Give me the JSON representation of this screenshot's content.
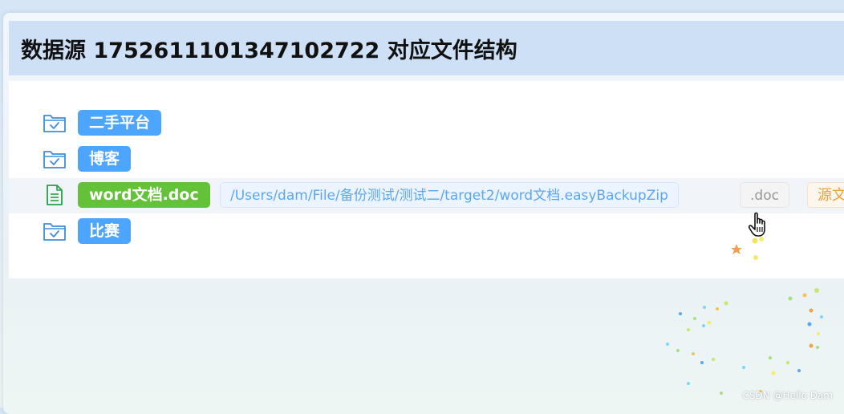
{
  "header": {
    "title": "数据源 1752611101347102722 对应文件结构"
  },
  "tree": {
    "items": [
      {
        "type": "folder",
        "icon": "folder-check-icon",
        "label": "二手平台"
      },
      {
        "type": "folder",
        "icon": "folder-check-icon",
        "label": "博客"
      },
      {
        "type": "file",
        "icon": "document-icon",
        "label": "word文档.doc",
        "path": "/Users/dam/File/备份测试/测试二/target2/word文档.easyBackupZip",
        "extension": ".doc",
        "source_tag": "源文"
      },
      {
        "type": "folder",
        "icon": "folder-check-icon",
        "label": "比赛"
      }
    ]
  },
  "watermark": "CSDN @Hello Dam",
  "colors": {
    "header_bg": "#cde0f6",
    "primary_tag": "#4ea5fd",
    "success_tag": "#63c237",
    "folder_icon": "#3d8fd9",
    "file_icon": "#27a045"
  }
}
